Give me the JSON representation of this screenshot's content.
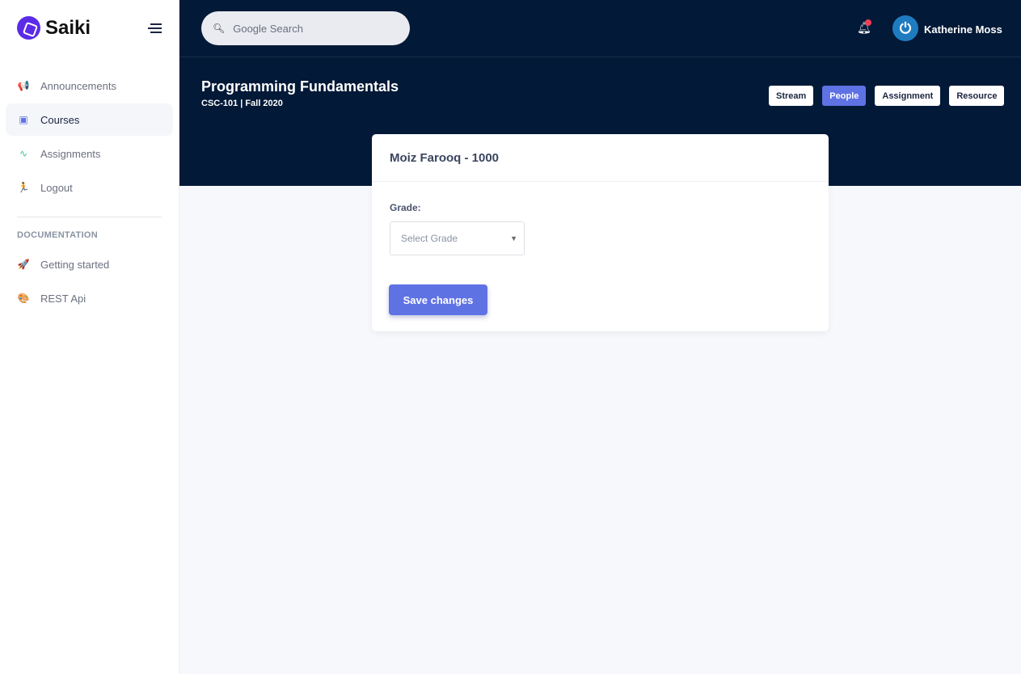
{
  "brand": "Saiki",
  "sidebar": {
    "items": [
      {
        "label": "Announcements",
        "icon": "megaphone-icon"
      },
      {
        "label": "Courses",
        "icon": "notebook-icon",
        "active": true
      },
      {
        "label": "Assignments",
        "icon": "pulse-icon"
      },
      {
        "label": "Logout",
        "icon": "running-icon"
      }
    ],
    "section_title": "DOCUMENTATION",
    "doc_items": [
      {
        "label": "Getting started",
        "icon": "rocket-icon"
      },
      {
        "label": "REST Api",
        "icon": "palette-icon"
      }
    ]
  },
  "header": {
    "search_placeholder": "Google Search",
    "user_name": "Katherine Moss",
    "avatar_glyph": "⏻"
  },
  "course": {
    "title": "Programming Fundamentals",
    "subtitle": "CSC-101 | Fall 2020",
    "tabs": [
      {
        "label": "Stream"
      },
      {
        "label": "People",
        "active": true
      },
      {
        "label": "Assignment"
      },
      {
        "label": "Resource"
      }
    ]
  },
  "card": {
    "title": "Moiz Farooq - 1000",
    "grade_label": "Grade:",
    "grade_placeholder": "Select Grade",
    "save_label": "Save changes"
  },
  "colors": {
    "accent": "#5f72e4",
    "header_bg": "#021937",
    "brand": "#5b2be8"
  }
}
